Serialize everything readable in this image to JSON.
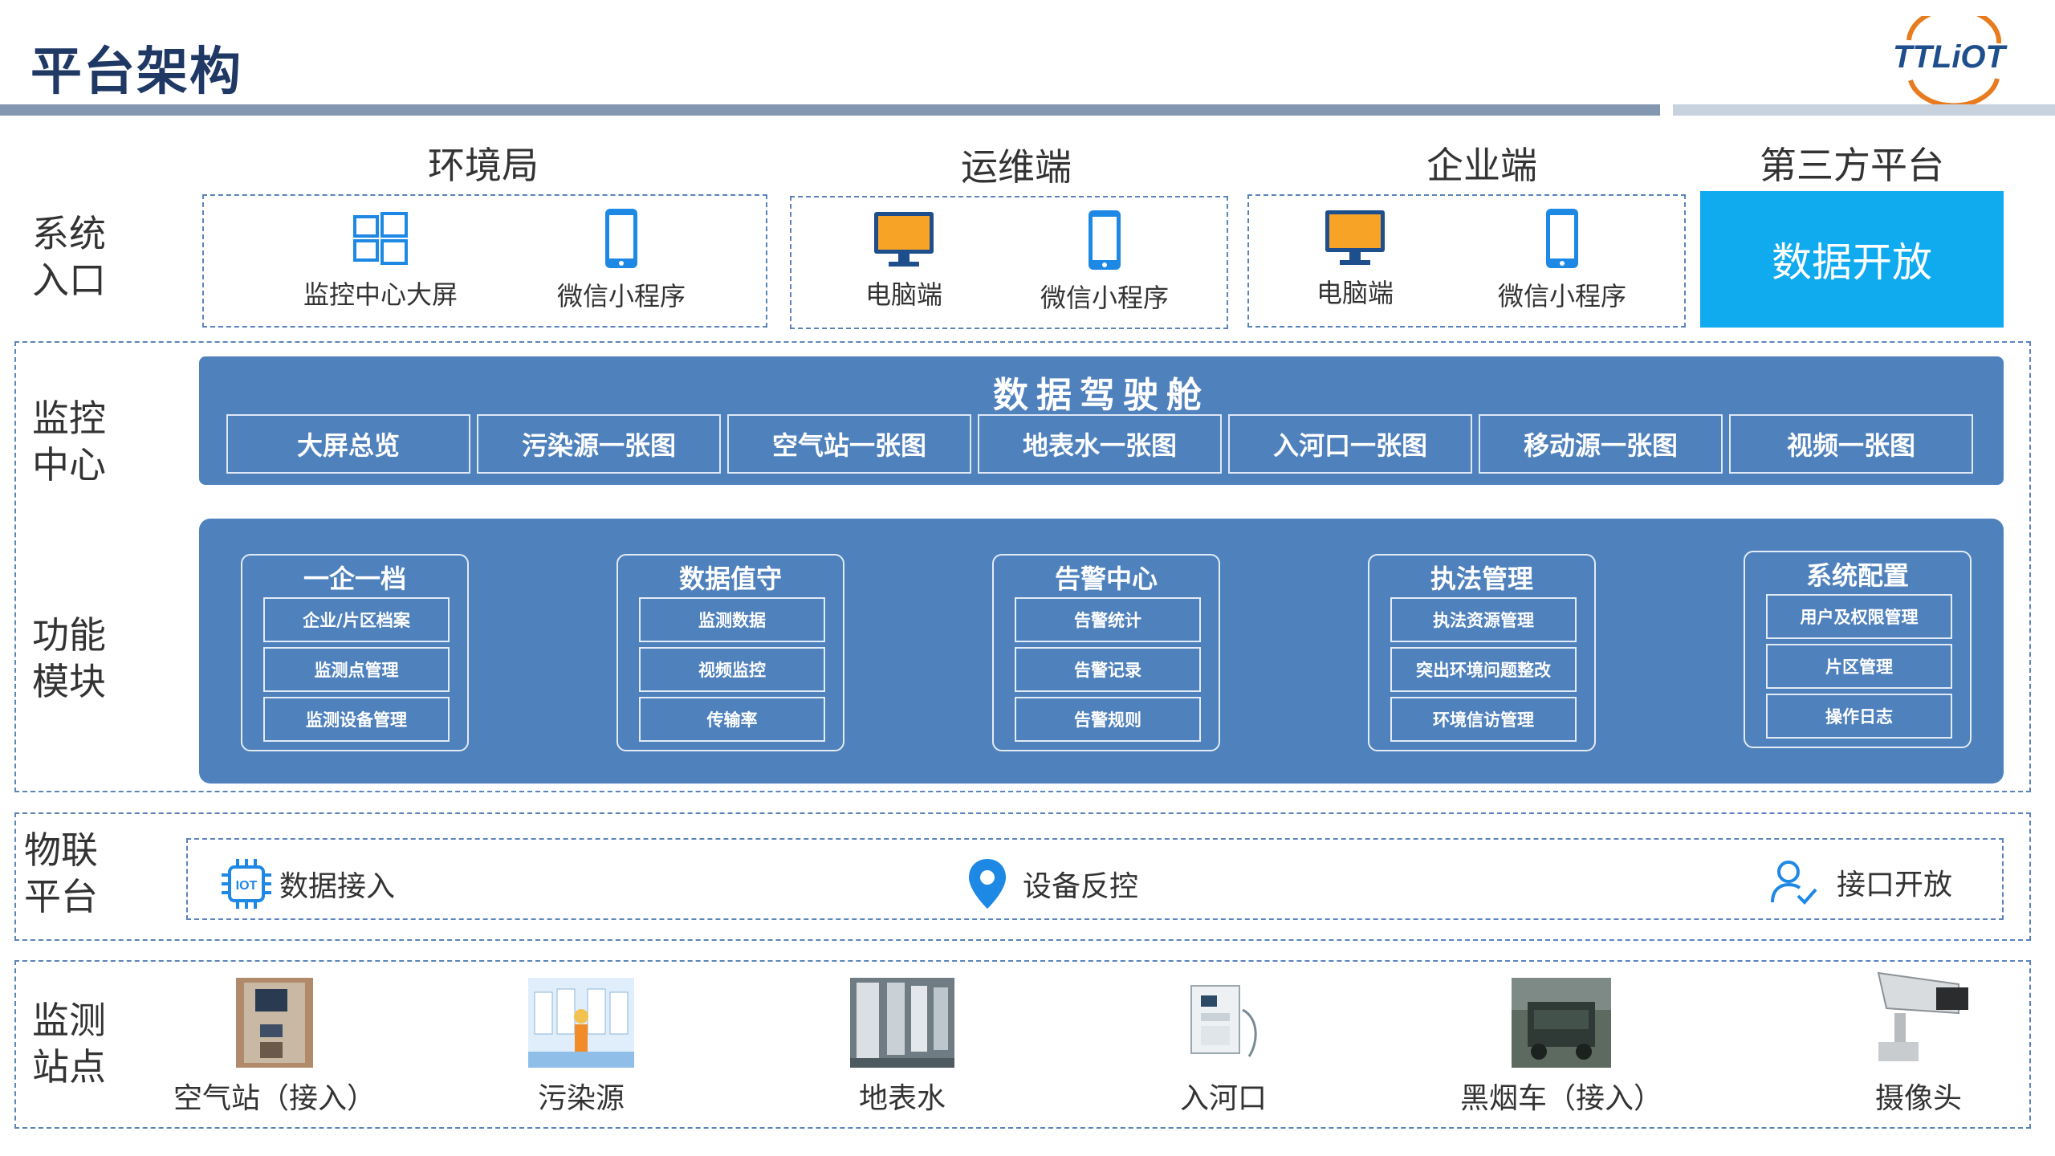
{
  "header": {
    "title": "平台架构",
    "logo_text": "TTLiOT"
  },
  "rows": {
    "system_entry": "系统\n入口",
    "monitor_center": "监控\n中心",
    "function_module": "功能\n模块",
    "iot_platform": "物联\n平台",
    "monitor_sites": "监测\n站点"
  },
  "clients": [
    {
      "title": "环境局",
      "items": [
        {
          "label": "监控中心大屏",
          "icon": "windows-icon"
        },
        {
          "label": "微信小程序",
          "icon": "phone-icon"
        }
      ]
    },
    {
      "title": "运维端",
      "items": [
        {
          "label": "电脑端",
          "icon": "monitor-icon"
        },
        {
          "label": "微信小程序",
          "icon": "phone-icon"
        }
      ]
    },
    {
      "title": "企业端",
      "items": [
        {
          "label": "电脑端",
          "icon": "monitor-icon"
        },
        {
          "label": "微信小程序",
          "icon": "phone-icon"
        }
      ]
    },
    {
      "title": "第三方平台",
      "items": [
        {
          "label": "数据开放"
        }
      ]
    }
  ],
  "cockpit": {
    "title": "数据驾驶舱",
    "tabs": [
      "大屏总览",
      "污染源一张图",
      "空气站一张图",
      "地表水一张图",
      "入河口一张图",
      "移动源一张图",
      "视频一张图"
    ]
  },
  "modules": [
    {
      "title": "一企一档",
      "items": [
        "企业/片区档案",
        "监测点管理",
        "监测设备管理"
      ]
    },
    {
      "title": "数据值守",
      "items": [
        "监测数据",
        "视频监控",
        "传输率"
      ]
    },
    {
      "title": "告警中心",
      "items": [
        "告警统计",
        "告警记录",
        "告警规则"
      ]
    },
    {
      "title": "执法管理",
      "items": [
        "执法资源管理",
        "突出环境问题整改",
        "环境信访管理"
      ]
    },
    {
      "title": "系统配置",
      "items": [
        "用户及权限管理",
        "片区管理",
        "操作日志"
      ]
    }
  ],
  "iot": [
    {
      "label": "数据接入",
      "icon": "iot-chip-icon"
    },
    {
      "label": "设备反控",
      "icon": "location-pin-icon"
    },
    {
      "label": "接口开放",
      "icon": "user-check-icon"
    }
  ],
  "sites": [
    "空气站（接入）",
    "污染源",
    "地表水",
    "入河口",
    "黑烟车（接入）",
    "摄像头"
  ],
  "colors": {
    "primary_blue": "#4f81bd",
    "open_blue": "#10aaee",
    "title_navy": "#1f3864",
    "dash_border": "#5b84bc"
  }
}
